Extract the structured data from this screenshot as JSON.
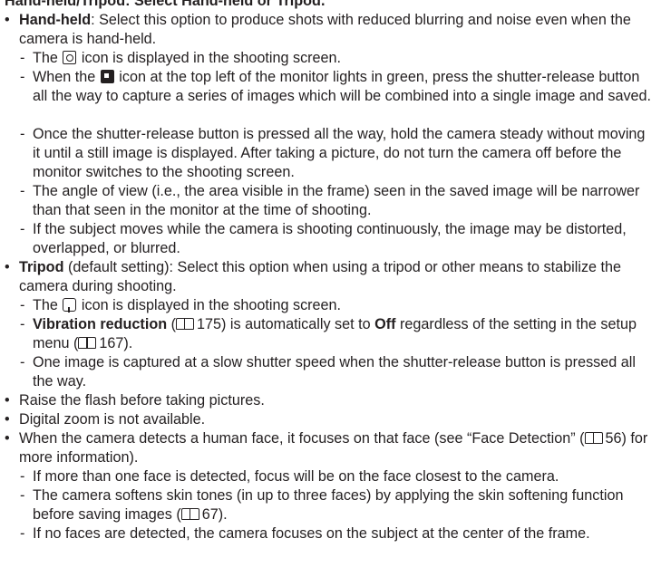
{
  "heading": "Hand-held/Tripod: Select Hand-held or Tripod.",
  "sections": {
    "handheld": {
      "label": "Hand-held",
      "text": ": Select this option to produce shots with reduced blurring and noise even when the camera is hand-held.",
      "sub1_a": "The",
      "sub1_icon": "hand-held-mode-icon",
      "sub1_b": "icon is displayed in the shooting screen.",
      "sub2_a": "When the",
      "sub2_icon": "ready-indicator-icon",
      "sub2_b": "icon at the top left of the monitor lights in green, press the shutter-release button all the way to capture a series of images which will be combined into a single image and saved.",
      "sub3": "Once the shutter-release button is pressed all the way, hold the camera steady without moving it until a still image is displayed. After taking a picture, do not turn the camera off before the monitor switches to the shooting screen.",
      "sub4": "The angle of view (i.e., the area visible in the frame) seen in the saved image will be narrower than that seen in the monitor at the time of shooting.",
      "sub5": "If the subject moves while the camera is shooting continuously, the image may be distorted, overlapped, or blurred."
    },
    "tripod": {
      "label": "Tripod",
      "text": " (default setting): Select this option when using a tripod or other means to stabilize the camera during shooting.",
      "sub1_a": "The",
      "sub1_icon": "tripod-mode-icon",
      "sub1_b": "icon is displayed in the shooting screen.",
      "sub2_bold": "Vibration reduction",
      "sub2_a": "(",
      "sub2_ref_icon": "book-reference-icon",
      "sub2_ref": "175) is automatically set to",
      "sub2_bold2": "Off",
      "sub2_b": "regardless of the setting in the setup menu (",
      "sub2_ref2": "167).",
      "sub3": "One image is captured at a slow shutter speed when the shutter-release button is pressed all the way."
    },
    "flash": "Raise the flash before taking pictures.",
    "zoom": "Digital zoom is not available.",
    "face": {
      "text_a": "When the camera detects a human face, it focuses on that face (see “Face Detection”",
      "text_b": "(",
      "ref": "56) for more information).",
      "sub1": "If more than one face is detected, focus will be on the face closest to the camera.",
      "sub2_a": "The camera softens skin tones (in up to three faces) by applying the skin softening function before saving images (",
      "sub2_ref": "67).",
      "sub3": "If no faces are detected, the camera focuses on the subject at the center of the frame."
    }
  }
}
